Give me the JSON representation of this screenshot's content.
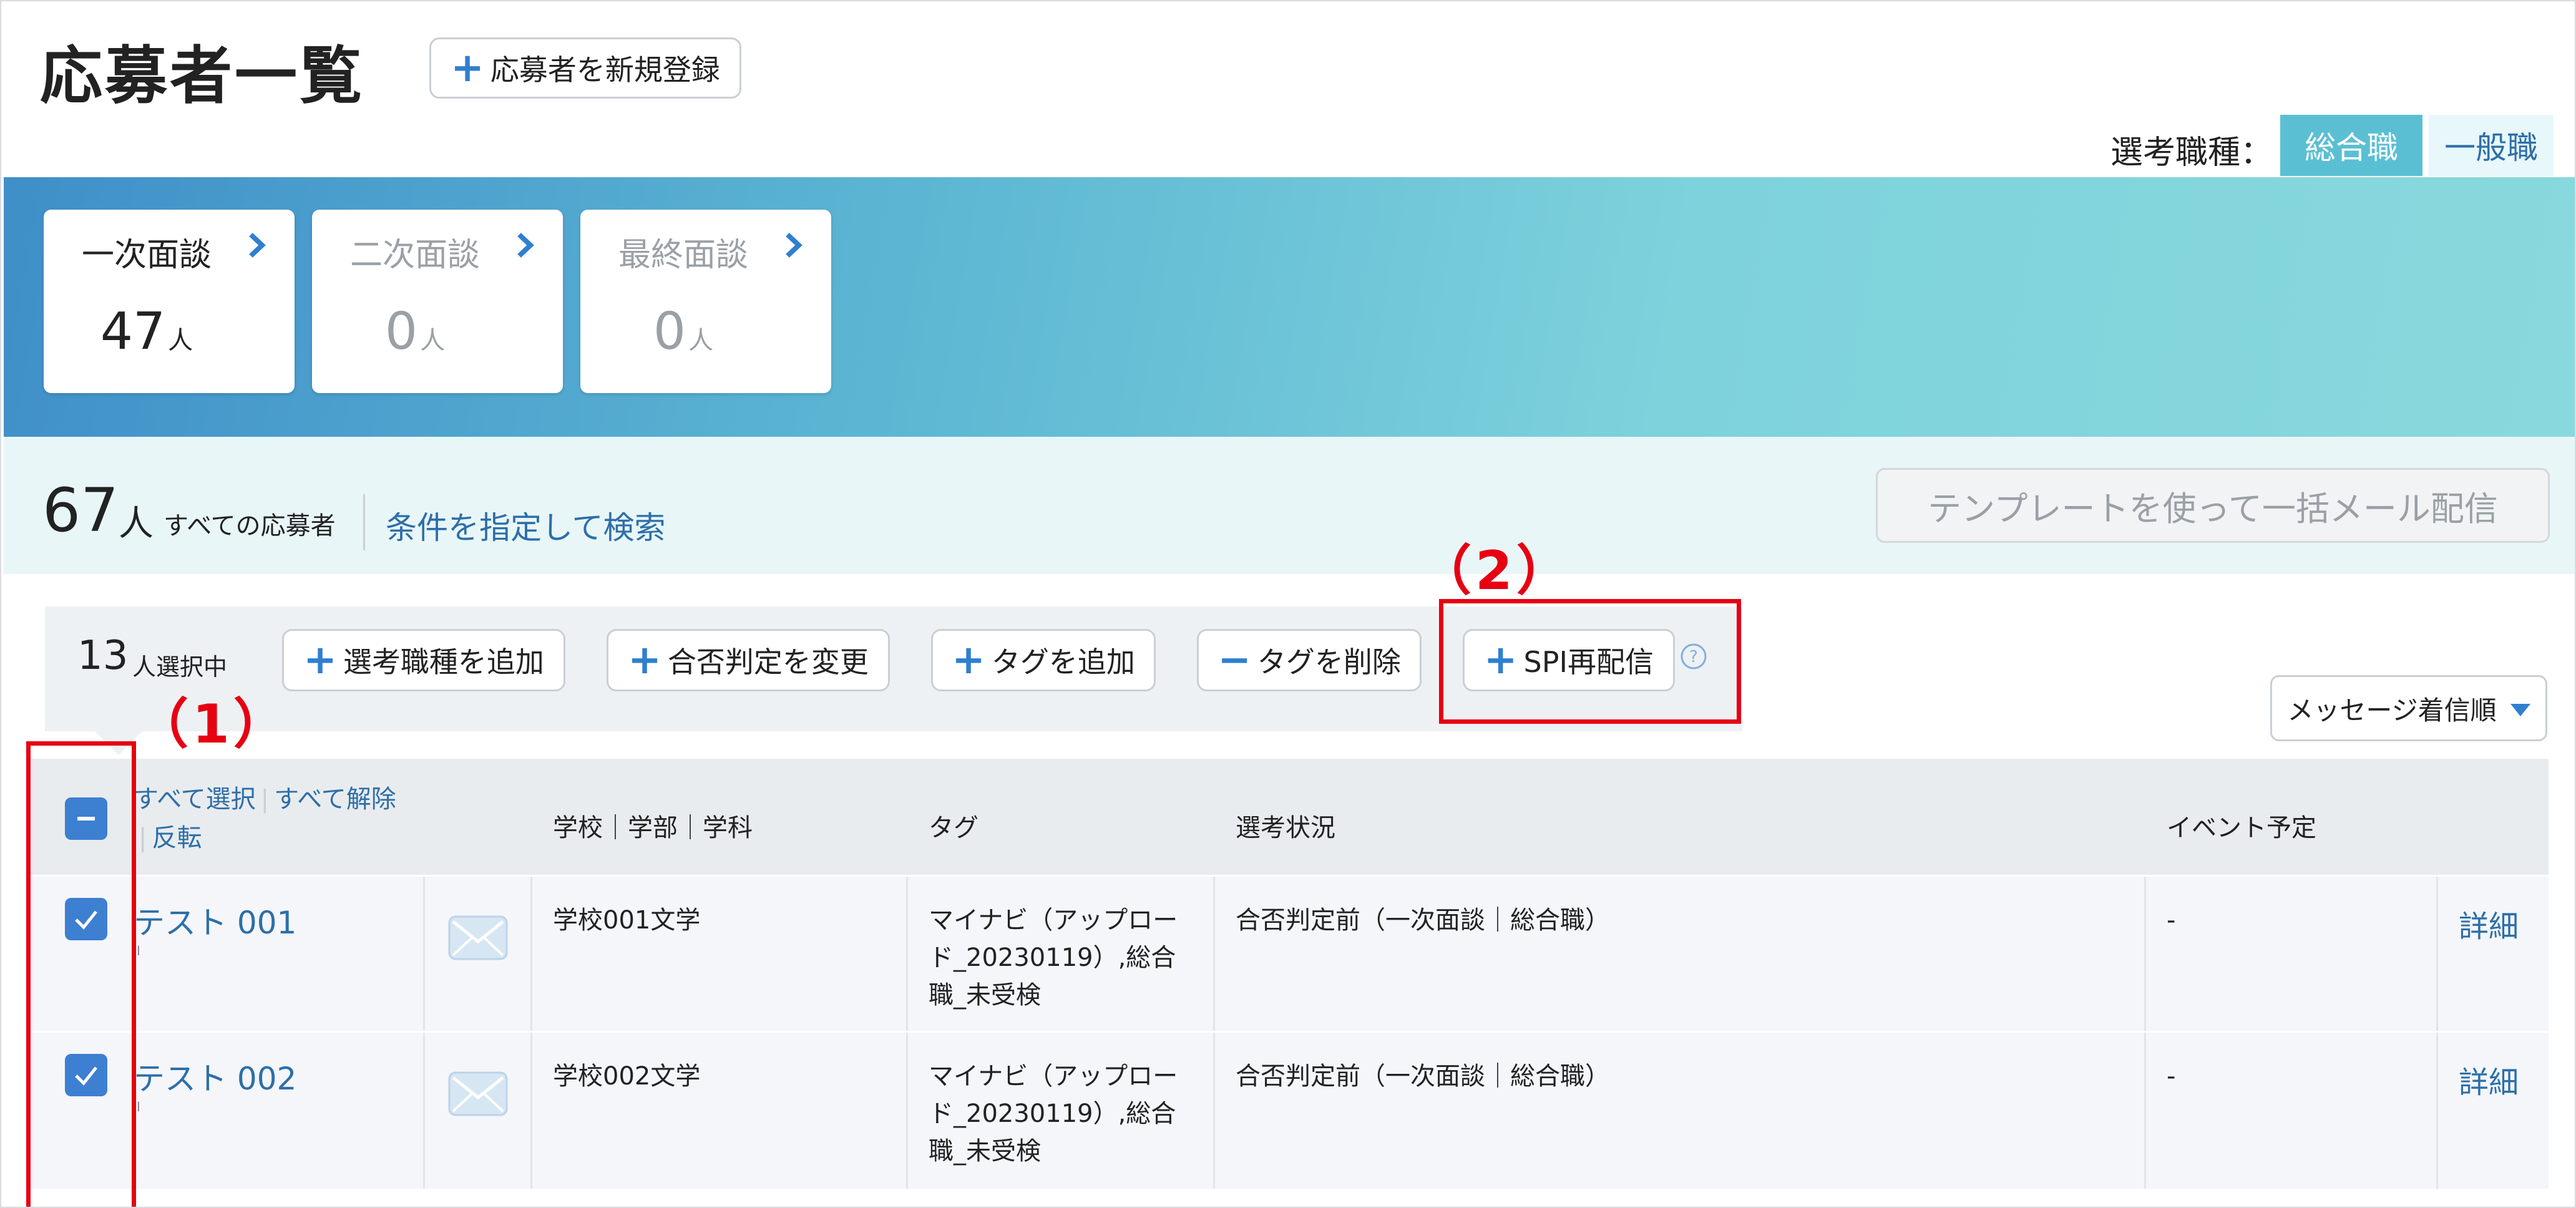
{
  "header": {
    "title": "応募者一覧",
    "new_applicant_button": "応募者を新規登録",
    "job_type_label": "選考職種：",
    "job_types": [
      "総合職",
      "一般職"
    ]
  },
  "stages": [
    {
      "name": "一次面談",
      "count": "47",
      "unit": "人"
    },
    {
      "name": "二次面談",
      "count": "0",
      "unit": "人"
    },
    {
      "name": "最終面談",
      "count": "0",
      "unit": "人"
    }
  ],
  "summary": {
    "total_count": "67",
    "total_unit": "人",
    "total_label": "すべての応募者",
    "search_link": "条件を指定して検索",
    "template_mail_button": "テンプレートを使って一括メール配信"
  },
  "selection": {
    "count": "13",
    "unit": "人選択中",
    "actions": [
      "選考職種を追加",
      "合否判定を変更",
      "タグを追加",
      "タグを削除",
      "SPI再配信"
    ]
  },
  "sort_button": "メッセージ着信順",
  "table": {
    "select_all": "すべて選択",
    "deselect_all": "すべて解除",
    "invert": "反転",
    "headers": [
      "学校｜学部｜学科",
      "タグ",
      "選考状況",
      "イベント予定"
    ],
    "rows": [
      {
        "name": "テスト 001",
        "school": "学校001文学",
        "tag_lines": [
          "マイナビ（アップロー",
          "ド_20230119）,総合",
          "職_未受検"
        ],
        "status": "合否判定前（一次面談｜総合職）",
        "event": "-",
        "detail": "詳細"
      },
      {
        "name": "テスト 002",
        "school": "学校002文学",
        "tag_lines": [
          "マイナビ（アップロー",
          "ド_20230119）,総合",
          "職_未受検"
        ],
        "status": "合否判定前（一次面談｜総合職）",
        "event": "-",
        "detail": "詳細"
      }
    ]
  },
  "annotations": [
    "（1）",
    "（2）"
  ],
  "colors": {
    "accent": "#2f7fd1",
    "link": "#2d6fa8",
    "job_active_bg": "#5bbfd3",
    "annotation": "#e60012"
  }
}
